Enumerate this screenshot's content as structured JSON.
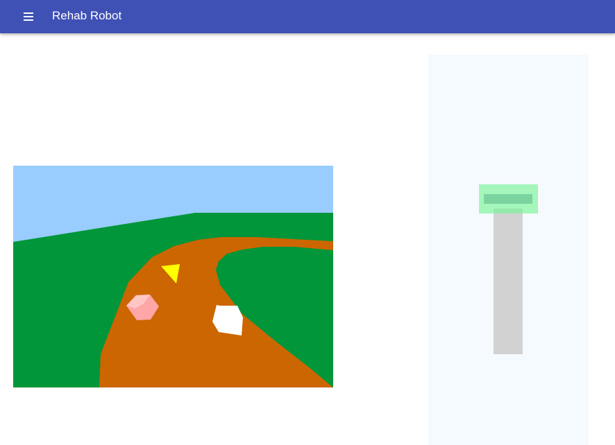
{
  "app": {
    "title": "Rehab Robot",
    "menu_icon": "menu-icon"
  },
  "colors": {
    "appbar": "#3f51b5",
    "sky": "#99ccff",
    "grass": "#009639",
    "path": "#cc6600",
    "panel": "#f5faff",
    "track": "#d2d2d2",
    "handle": "#78f596"
  },
  "scene": {
    "objects": [
      {
        "name": "yellow-triangle-target",
        "color": "#ffff00"
      },
      {
        "name": "pink-gem-target",
        "color": "#ff9999"
      },
      {
        "name": "white-rock-obstacle",
        "color": "#ffffff"
      }
    ]
  },
  "control": {
    "handle_color": "#78f596",
    "track_color": "#d2d2d2"
  }
}
